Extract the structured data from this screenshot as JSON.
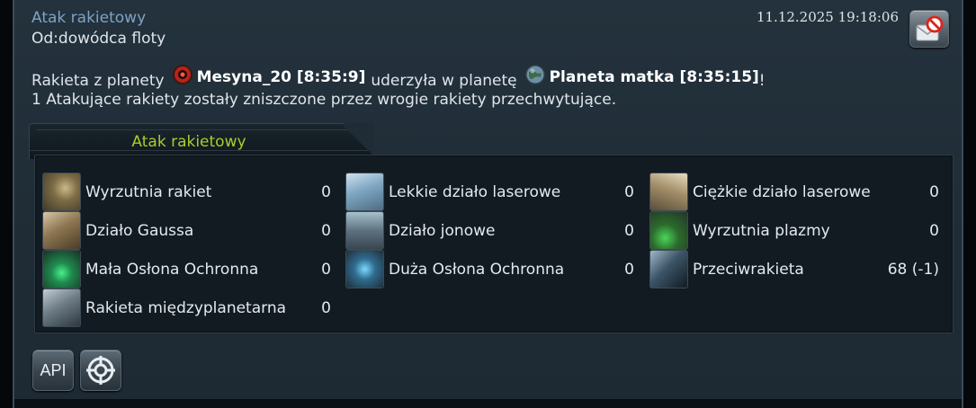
{
  "message": {
    "subject": "Atak rakietowy",
    "from": "Od:dowódca floty",
    "date": "11.12.2025 19:18:06",
    "delete_icon": "mail-delete-icon"
  },
  "body": {
    "prefix": "Rakieta z planety",
    "source_planet": "Mesyna_20 [8:35:9]",
    "middle": "uderzyła w planetę",
    "target_planet": "Planeta matka [8:35:15]",
    "suffix": "!",
    "line2": "1 Atakujące rakiety zostały zniszczone przez wrogie rakiety przechwytujące."
  },
  "report": {
    "tab_label": "Atak rakietowy",
    "units": [
      {
        "name": "Wyrzutnia rakiet",
        "count": "0"
      },
      {
        "name": "Lekkie działo laserowe",
        "count": "0"
      },
      {
        "name": "Ciężkie działo laserowe",
        "count": "0"
      },
      {
        "name": "Działo Gaussa",
        "count": "0"
      },
      {
        "name": "Działo jonowe",
        "count": "0"
      },
      {
        "name": "Wyrzutnia plazmy",
        "count": "0"
      },
      {
        "name": "Mała Osłona Ochronna",
        "count": "0"
      },
      {
        "name": "Duża Osłona Ochronna",
        "count": "0"
      },
      {
        "name": "Przeciwrakieta",
        "count": "68 (-1)"
      },
      {
        "name": "Rakieta międzyplanetarna",
        "count": "0"
      }
    ]
  },
  "footer": {
    "api_label": "API",
    "target_icon": "crosshair-icon"
  },
  "colors": {
    "subject": "#7ea3c6",
    "tab_label": "#a8cc2d",
    "panel_bg": "#1f2c36"
  }
}
